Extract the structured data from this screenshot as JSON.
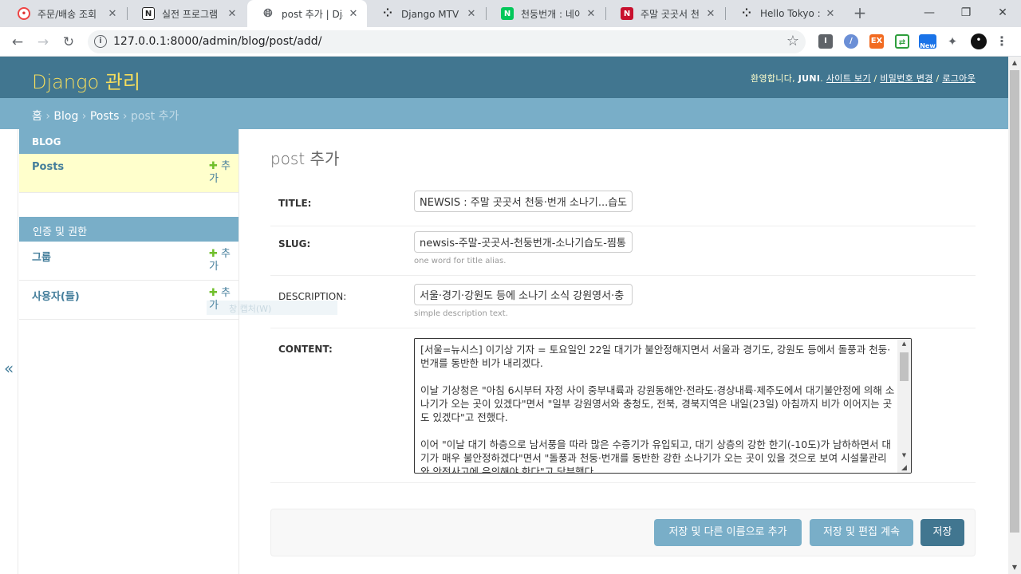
{
  "browser": {
    "tabs": [
      {
        "title": "주문/배송 조회",
        "icon": "red-circle"
      },
      {
        "title": "실전 프로그램",
        "icon": "notion-n"
      },
      {
        "title": "post 추가 | Djan",
        "icon": "globe"
      },
      {
        "title": "Django MTV 패",
        "icon": "dots"
      },
      {
        "title": "천둥번개 : 네이",
        "icon": "naver-n"
      },
      {
        "title": "주말 곳곳서 천",
        "icon": "newsis-n"
      },
      {
        "title": "Hello Tokyo ::",
        "icon": "dots"
      }
    ],
    "url": "127.0.0.1:8000/admin/blog/post/add/",
    "ext_new_badge": "New"
  },
  "admin": {
    "brand": "Django 관리",
    "welcome": "환영합니다,",
    "username": "JUNI",
    "view_site": "사이트 보기",
    "change_password": "비밀번호 변경",
    "logout": "로그아웃",
    "breadcrumbs": {
      "home": "홈",
      "app": "Blog",
      "model": "Posts",
      "current": "post 추가"
    }
  },
  "sidebar": {
    "blog_caption": "BLOG",
    "posts": "Posts",
    "add": "추가",
    "auth_caption": "인증 및 권한",
    "groups": "그룹",
    "users": "사용자(들)",
    "ghost_text": "창 캡처(W)"
  },
  "form": {
    "heading": "post 추가",
    "title_label": "TITLE:",
    "title_value": "NEWSIS : 주말 곳곳서 천둥·번개 소나기...습도",
    "slug_label": "SLUG:",
    "slug_value": "newsis-주말-곳곳서-천둥번개-소나기습도-찜통",
    "slug_help": "one word for title alias.",
    "desc_label": "DESCRIPTION:",
    "desc_value": "서울·경기·강원도 등에 소나기 소식 강원영서·충",
    "desc_help": "simple description text.",
    "content_label": "CONTENT:",
    "content_p1": "[서울=뉴시스] 이기상 기자 = 토요일인 22일 대기가 불안정해지면서 서울과 경기도, 강원도 등에서 돌풍과 천둥·번개를 동반한 비가 내리겠다.",
    "content_p2": "이날 기상청은 \"아침 6시부터 자정 사이 중부내륙과 강원동해안·전라도·경상내륙·제주도에서 대기불안정에 의해 소나기가 오는 곳이 있겠다\"면서 \"일부 강원영서와 충청도, 전북, 경북지역은 내일(23일) 아침까지 비가 이어지는 곳도 있겠다\"고 전했다.",
    "content_p3": "이어 \"이날 대기 하층으로 남서풍을 따라 많은 수증기가 유입되고, 대기 상층의 강한 한기(-10도)가 남하하면서 대기가 매우 불안정하겠다\"면서 \"돌풍과 천둥·번개를 동반한 강한 소나기가 오는 곳이 있을 것으로 보여 시설물관리와 안전사고에 유의해야 한다\"고 당부했다."
  },
  "buttons": {
    "save_add": "저장 및 다른 이름으로 추가",
    "save_continue": "저장 및 편집 계속",
    "save": "저장"
  }
}
